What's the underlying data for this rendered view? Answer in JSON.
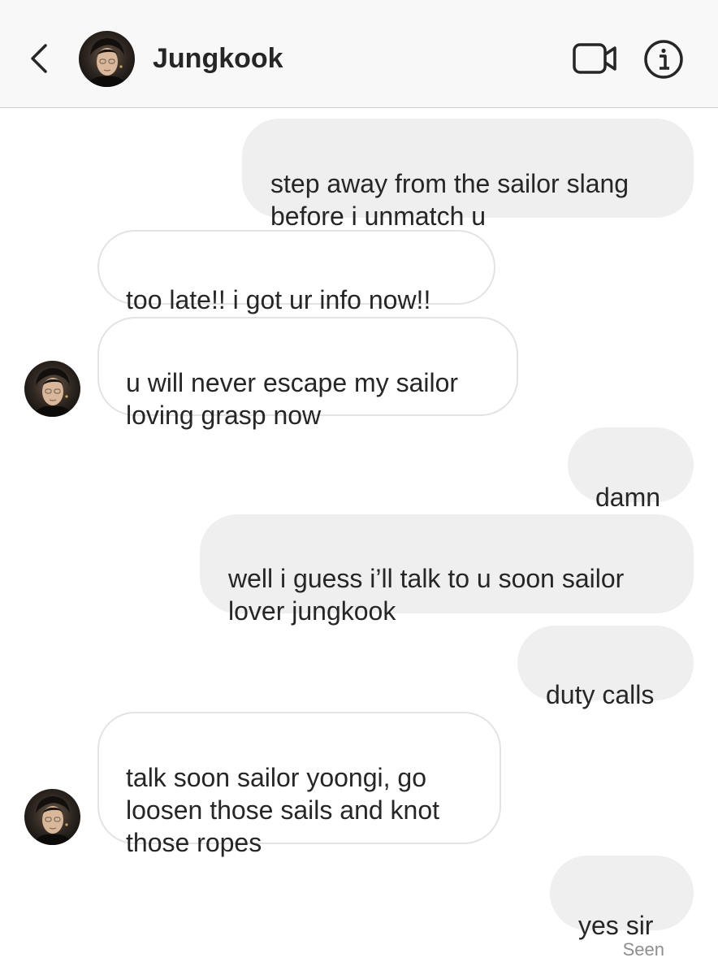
{
  "header": {
    "title": "Jungkook"
  },
  "messages": [
    {
      "id": "m1",
      "direction": "sent",
      "text": "step away from the sailor slang\nbefore i unmatch u"
    },
    {
      "id": "m2",
      "direction": "received",
      "text": "too late!! i got ur info now!!"
    },
    {
      "id": "m3",
      "direction": "received",
      "text": "u will never escape my sailor\nloving grasp now"
    },
    {
      "id": "m4",
      "direction": "sent",
      "text": "damn"
    },
    {
      "id": "m5",
      "direction": "sent",
      "text": "well i guess i’ll talk to u soon sailor\nlover jungkook"
    },
    {
      "id": "m6",
      "direction": "sent",
      "text": "duty calls"
    },
    {
      "id": "m7",
      "direction": "received",
      "text": "talk soon sailor yoongi, go\nloosen those sails and knot\nthose ropes"
    },
    {
      "id": "m8",
      "direction": "sent",
      "text": "yes sir"
    }
  ],
  "status": {
    "seen": "Seen"
  },
  "icons": {
    "back": "chevron-left-icon",
    "video": "video-camera-icon",
    "info": "info-icon"
  },
  "colors": {
    "sent_bubble": "#efefef",
    "received_border": "#e3e3e3",
    "header_bg": "#f8f8f8",
    "text": "#262626",
    "seen_text": "#8e8e8e"
  }
}
